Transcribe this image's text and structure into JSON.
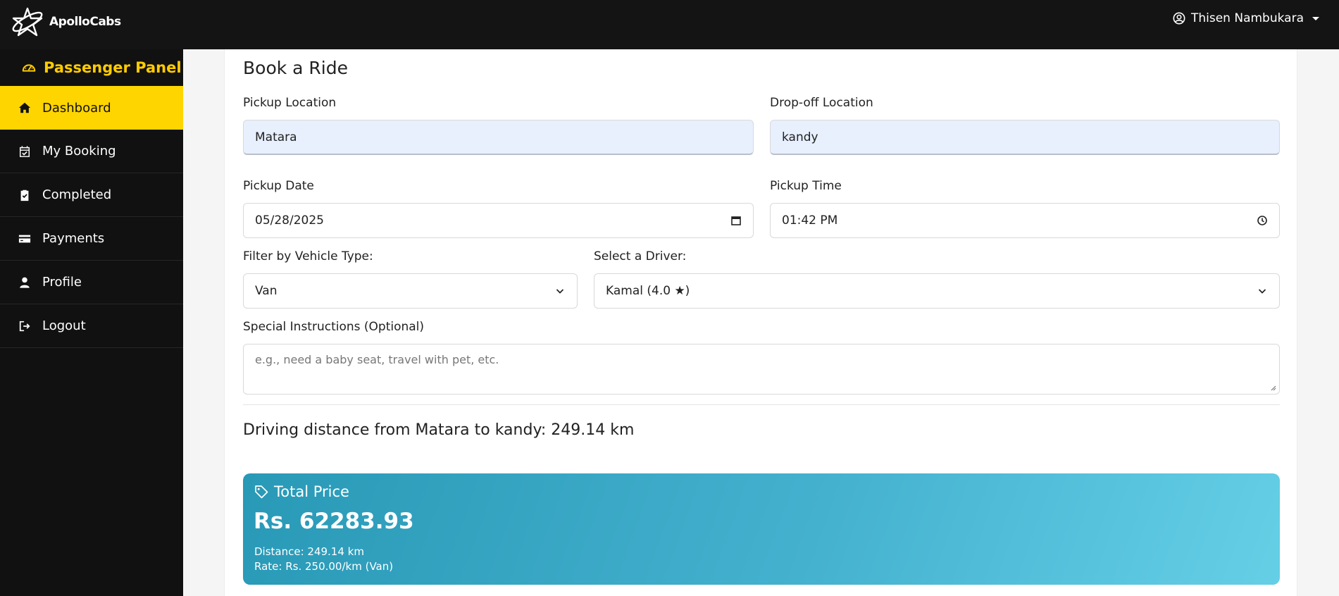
{
  "app": {
    "brand": "ApolloCabs",
    "user_name": "Thisen Nambukara"
  },
  "sidebar": {
    "panel_title": "Passenger Panel",
    "items": [
      {
        "label": "Dashboard",
        "icon": "home-icon",
        "active": true
      },
      {
        "label": "My Booking",
        "icon": "calendar-check-icon",
        "active": false
      },
      {
        "label": "Completed",
        "icon": "clipboard-check-icon",
        "active": false
      },
      {
        "label": "Payments",
        "icon": "credit-card-icon",
        "active": false
      },
      {
        "label": "Profile",
        "icon": "user-icon",
        "active": false
      },
      {
        "label": "Logout",
        "icon": "logout-icon",
        "active": false
      }
    ]
  },
  "form": {
    "title": "Book a Ride",
    "pickup_label": "Pickup Location",
    "pickup_value": "Matara",
    "dropoff_label": "Drop-off Location",
    "dropoff_value": "kandy",
    "date_label": "Pickup Date",
    "date_value": "05/28/2025",
    "time_label": "Pickup Time",
    "time_value": "01:42 PM",
    "vehicle_label": "Filter by Vehicle Type:",
    "vehicle_value": "Van",
    "driver_label": "Select a Driver:",
    "driver_value": "Kamal (4.0 ★)",
    "instructions_label": "Special Instructions (Optional)",
    "instructions_placeholder": "e.g., need a baby seat, travel with pet, etc."
  },
  "distance_text": "Driving distance from Matara to kandy: 249.14 km",
  "price": {
    "title": "Total Price",
    "amount": "Rs. 62283.93",
    "distance_line": "Distance: 249.14 km",
    "rate_line": "Rate: Rs. 250.00/km (Van)"
  },
  "colors": {
    "accent": "#ffd500",
    "panel_title": "#ffcc00",
    "price_start": "#2899b6",
    "price_end": "#65cfe6",
    "input_filled": "#e8f0fe"
  }
}
